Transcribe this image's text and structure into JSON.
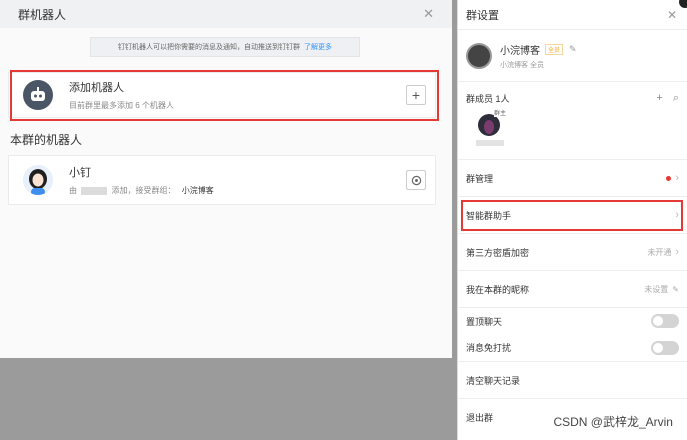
{
  "dialog": {
    "title": "群机器人",
    "notice": "钉钉机器人可以把你需要的消息及通知，自动推送到钉钉群",
    "notice_link": "了解更多",
    "add_card": {
      "title": "添加机器人",
      "subtitle": "目前群里最多添加 6 个机器人"
    },
    "section_title": "本群的机器人",
    "robot_card": {
      "title": "小钉",
      "sub_prefix": "由",
      "sub_mid": "添加，接受群组：",
      "sub_group": "小浣博客"
    }
  },
  "panel": {
    "title": "群设置",
    "profile": {
      "name": "小浣博客",
      "badge": "全员",
      "subtitle": "小浣博客 全员"
    },
    "members": {
      "label": "群成员 1人",
      "owner_tag": "群主"
    },
    "rows": {
      "group_manage": "群管理",
      "smart_assistant": "智能群助手",
      "third_party": "第三方密盾加密",
      "third_party_status": "未开通",
      "nickname": "我在本群的昵称",
      "nickname_status": "未设置",
      "pin_chat": "置顶聊天",
      "mute": "消息免打扰",
      "clear_history": "清空聊天记录",
      "exit": "退出群"
    }
  },
  "watermark": "CSDN @武梓龙_Arvin",
  "colors": {
    "highlight": "#e53935",
    "link": "#3296fa",
    "badge": "#f5a623"
  }
}
